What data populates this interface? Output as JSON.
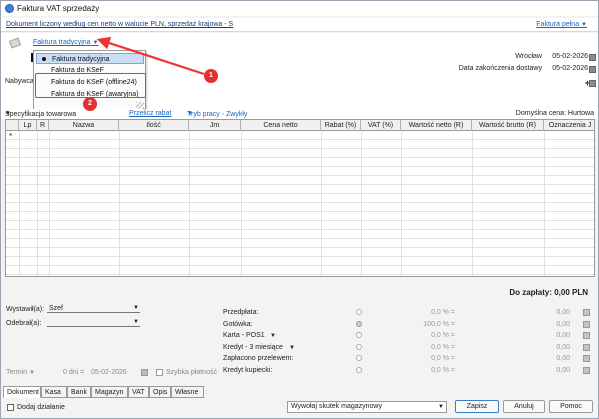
{
  "window": {
    "title": "Faktura VAT sprzedaży"
  },
  "subbar": {
    "description": "Dokument liczony według cen netto w walucie PLN, sprzedaż krajowa - S",
    "mode_link": "Faktura pełna"
  },
  "header": {
    "doc_type": "Faktura tradycyjna",
    "buyer_label": "Nabywca",
    "place": "Wrocław",
    "issue_date": "05-02-2026",
    "delivery_label": "Data zakończenia dostawy",
    "delivery_date": "05-02-2026"
  },
  "dropdown": {
    "items": [
      "Faktura tradycyjna",
      "Faktura do KSeF",
      "Faktura do KSeF (offline24)",
      "Faktura do KSeF (awaryjna)"
    ],
    "selected_index": 0
  },
  "annotations": {
    "badge1": "1",
    "badge2": "2",
    "accent": "#e4312f"
  },
  "spec": {
    "spec_label": "Specyfikacja towarowa",
    "discount_link": "Przelicz rabat",
    "mode_link": "Tryb pracy - Zwykły",
    "default_price": "Domyślna cena: Hurtowa"
  },
  "grid": {
    "columns": [
      "Lp",
      "R",
      "Nazwa",
      "Ilość",
      "Jm",
      "Cena netto",
      "Rabat (%)",
      "VAT (%)",
      "Wartość netto (R)",
      "Wartość brutto (R)",
      "Oznaczenia J"
    ],
    "new_row_marker": "*"
  },
  "totals": {
    "to_pay": "Do zapłaty: 0,00 PLN"
  },
  "lower": {
    "issued_by_label": "Wystawił(a):",
    "issued_by_value": "Szef",
    "received_by_label": "Odebrał(a):",
    "term_label": "Termin",
    "term_days": "0 dni =",
    "term_date": "05-02-2026",
    "quick_pay": "Szybka płatność",
    "payments": [
      {
        "label": "Przedpłata:",
        "pct": "0,0 % =",
        "amount": "0,00",
        "radio_on": false
      },
      {
        "label": "Gotówka:",
        "pct": "100,0 % =",
        "amount": "0,00",
        "radio_on": true
      },
      {
        "label": "Karta - POS1",
        "pct": "0,0 % =",
        "amount": "0,00",
        "radio_on": false
      },
      {
        "label": "Kredyt - 3 miesiące",
        "pct": "0,0 % =",
        "amount": "0,00",
        "radio_on": false
      },
      {
        "label": "Zapłacono przelewem:",
        "pct": "0,0 % =",
        "amount": "0,00",
        "radio_on": false
      },
      {
        "label": "Kredyt kupiecki:",
        "pct": "0,0 % =",
        "amount": "0,00",
        "radio_on": false
      }
    ]
  },
  "tabs": [
    "Dokument",
    "Kasa",
    "Bank",
    "Magazyn",
    "VAT",
    "Opis",
    "Własne"
  ],
  "footer": {
    "add_action": "Dodaj działanie",
    "stock_combo": "Wywołaj skutek magazynowy",
    "save": "Zapisz",
    "cancel": "Anuluj",
    "help": "Pomoc"
  }
}
